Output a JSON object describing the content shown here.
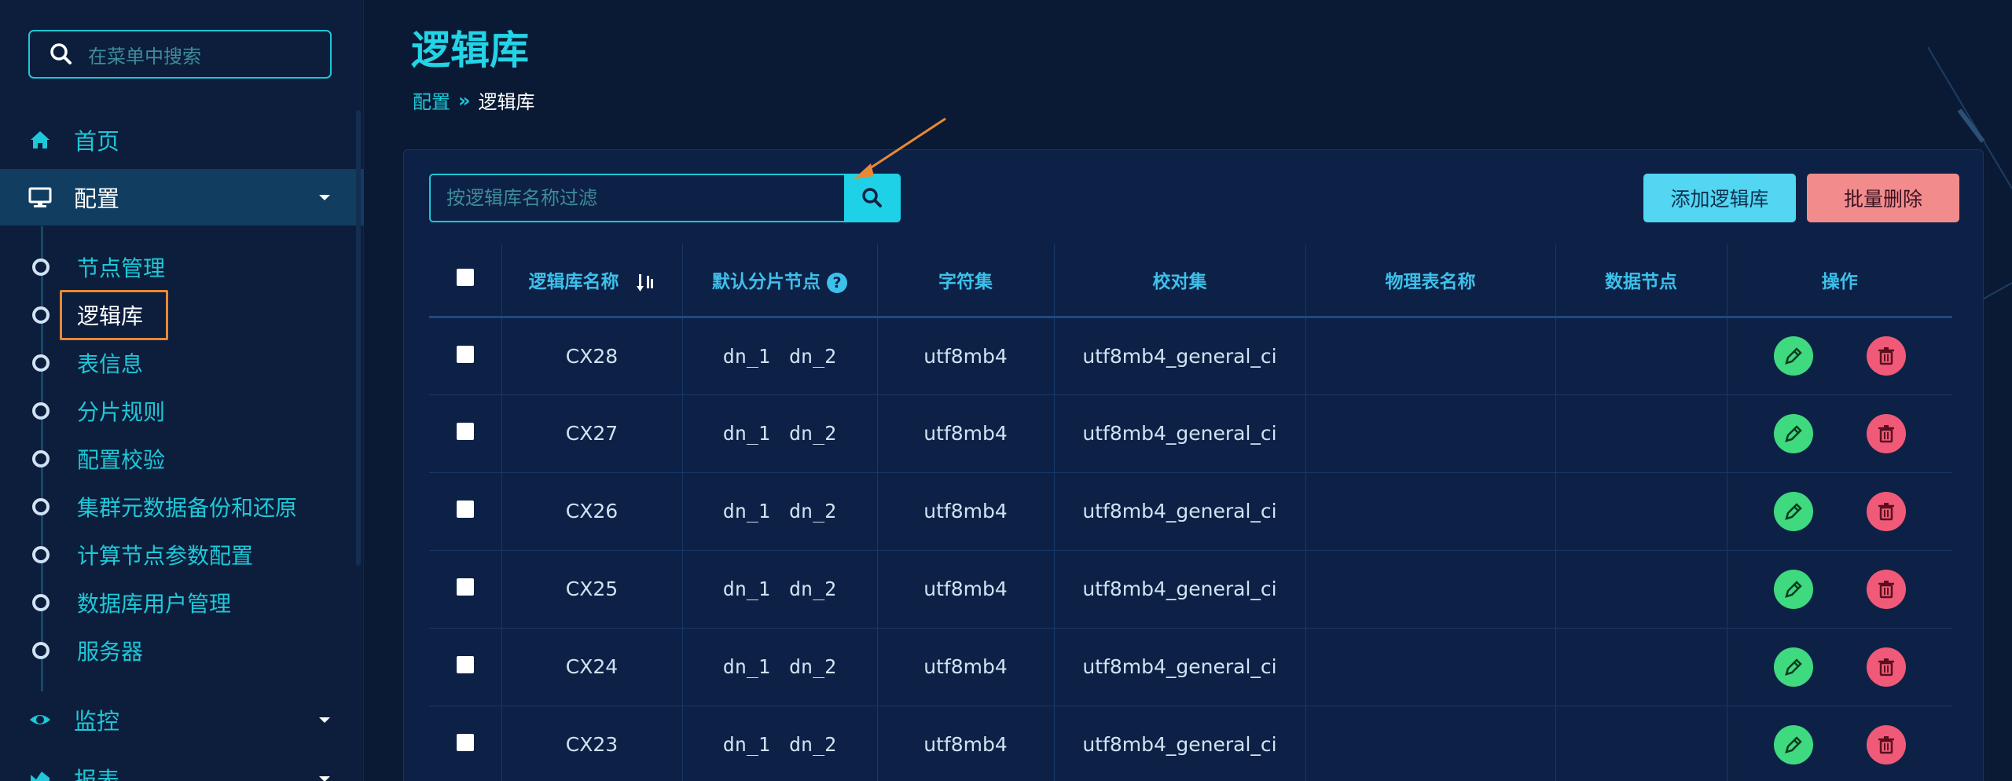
{
  "sidebar": {
    "search_placeholder": "在菜单中搜索",
    "home_label": "首页",
    "config_label": "配置",
    "sub_items": [
      "节点管理",
      "逻辑库",
      "表信息",
      "分片规则",
      "配置校验",
      "集群元数据备份和还原",
      "计算节点参数配置",
      "数据库用户管理",
      "服务器"
    ],
    "monitor_label": "监控",
    "report_label": "报表"
  },
  "header": {
    "title": "逻辑库",
    "breadcrumb_root": "配置",
    "breadcrumb_sep": "»",
    "breadcrumb_current": "逻辑库"
  },
  "toolbar": {
    "filter_placeholder": "按逻辑库名称过滤",
    "add_label": "添加逻辑库",
    "batch_delete_label": "批量删除"
  },
  "table": {
    "columns": [
      "逻辑库名称",
      "默认分片节点",
      "字符集",
      "校对集",
      "物理表名称",
      "数据节点",
      "操作"
    ],
    "rows": [
      {
        "name": "CX28",
        "nodes": [
          "dn_1",
          "dn_2"
        ],
        "charset": "utf8mb4",
        "collation": "utf8mb4_general_ci",
        "physical_table": "",
        "data_node": ""
      },
      {
        "name": "CX27",
        "nodes": [
          "dn_1",
          "dn_2"
        ],
        "charset": "utf8mb4",
        "collation": "utf8mb4_general_ci",
        "physical_table": "",
        "data_node": ""
      },
      {
        "name": "CX26",
        "nodes": [
          "dn_1",
          "dn_2"
        ],
        "charset": "utf8mb4",
        "collation": "utf8mb4_general_ci",
        "physical_table": "",
        "data_node": ""
      },
      {
        "name": "CX25",
        "nodes": [
          "dn_1",
          "dn_2"
        ],
        "charset": "utf8mb4",
        "collation": "utf8mb4_general_ci",
        "physical_table": "",
        "data_node": ""
      },
      {
        "name": "CX24",
        "nodes": [
          "dn_1",
          "dn_2"
        ],
        "charset": "utf8mb4",
        "collation": "utf8mb4_general_ci",
        "physical_table": "",
        "data_node": ""
      },
      {
        "name": "CX23",
        "nodes": [
          "dn_1",
          "dn_2"
        ],
        "charset": "utf8mb4",
        "collation": "utf8mb4_general_ci",
        "physical_table": "",
        "data_node": ""
      }
    ]
  },
  "colors": {
    "accent": "#1ec8d8",
    "background": "#0a1a35",
    "node_green": "#3fd97f",
    "delete_red": "#f05a78",
    "highlight_orange": "#e98835"
  },
  "icons": [
    "search-icon",
    "home-icon",
    "monitor-icon",
    "chevron-down-icon",
    "eye-icon",
    "chart-icon",
    "sort-icon",
    "help-icon",
    "pencil-icon",
    "trash-icon",
    "arrow-annotation"
  ]
}
